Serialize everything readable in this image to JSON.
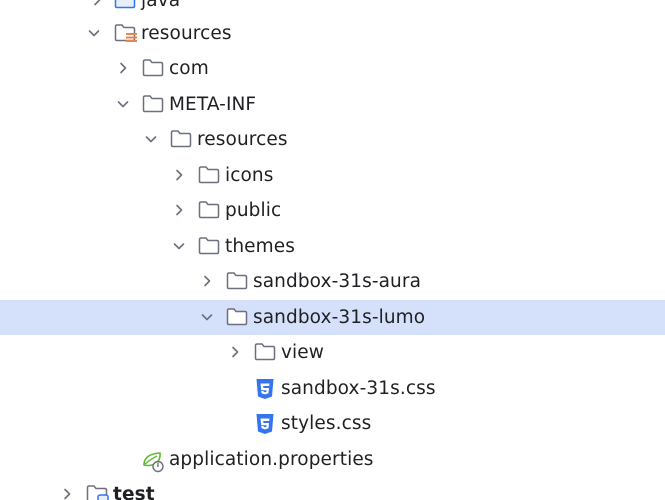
{
  "tree": {
    "items": [
      {
        "id": "java",
        "label": "java",
        "icon": "source-folder-icon",
        "state": "collapsed",
        "bold": false,
        "selected": false
      },
      {
        "id": "resources",
        "label": "resources",
        "icon": "resources-root-folder-icon",
        "state": "expanded",
        "bold": false,
        "selected": false
      },
      {
        "id": "com",
        "label": "com",
        "icon": "folder-icon",
        "state": "collapsed",
        "bold": false,
        "selected": false
      },
      {
        "id": "meta-inf",
        "label": "META-INF",
        "icon": "folder-icon",
        "state": "expanded",
        "bold": false,
        "selected": false
      },
      {
        "id": "meta-inf-resources",
        "label": "resources",
        "icon": "folder-icon",
        "state": "expanded",
        "bold": false,
        "selected": false
      },
      {
        "id": "icons",
        "label": "icons",
        "icon": "folder-icon",
        "state": "collapsed",
        "bold": false,
        "selected": false
      },
      {
        "id": "public",
        "label": "public",
        "icon": "folder-icon",
        "state": "collapsed",
        "bold": false,
        "selected": false
      },
      {
        "id": "themes",
        "label": "themes",
        "icon": "folder-icon",
        "state": "expanded",
        "bold": false,
        "selected": false
      },
      {
        "id": "sandbox-31s-aura",
        "label": "sandbox-31s-aura",
        "icon": "folder-icon",
        "state": "collapsed",
        "bold": false,
        "selected": false
      },
      {
        "id": "sandbox-31s-lumo",
        "label": "sandbox-31s-lumo",
        "icon": "folder-icon",
        "state": "expanded",
        "bold": false,
        "selected": true
      },
      {
        "id": "view",
        "label": "view",
        "icon": "folder-icon",
        "state": "collapsed",
        "bold": false,
        "selected": false
      },
      {
        "id": "sandbox-31s-css",
        "label": "sandbox-31s.css",
        "icon": "css-file-icon",
        "state": "leaf",
        "bold": false,
        "selected": false
      },
      {
        "id": "styles-css",
        "label": "styles.css",
        "icon": "css-file-icon",
        "state": "leaf",
        "bold": false,
        "selected": false
      },
      {
        "id": "application-properties",
        "label": "application.properties",
        "icon": "spring-properties-icon",
        "state": "leaf",
        "bold": false,
        "selected": false
      },
      {
        "id": "test",
        "label": "test",
        "icon": "test-source-folder-icon",
        "state": "collapsed",
        "bold": true,
        "selected": false
      }
    ]
  },
  "colors": {
    "selection": "#d5e0fb",
    "text": "#1f2023",
    "icon_stroke": "#6c707e",
    "css_icon": "#3574f0",
    "spring_icon": "#5fb832",
    "resources_accent": "#e08855"
  }
}
